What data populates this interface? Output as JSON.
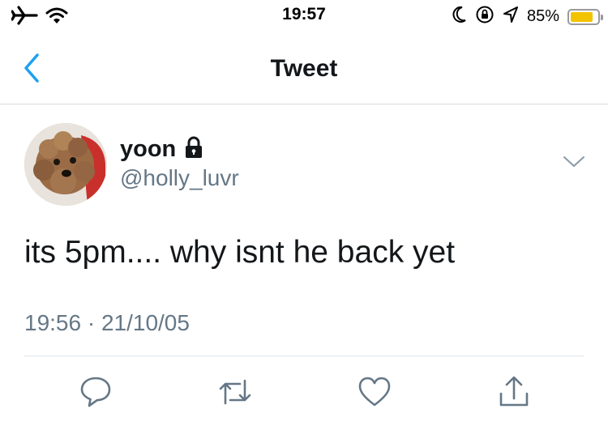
{
  "status_bar": {
    "time": "19:57",
    "battery_percent": "85%",
    "battery_level": 0.85,
    "battery_color": "#f2c300",
    "icons": [
      "airplane-icon",
      "wifi-icon",
      "moon-icon",
      "rotation-lock-icon",
      "location-icon",
      "battery-icon"
    ]
  },
  "nav": {
    "title": "Tweet",
    "back_icon": "chevron-left-icon",
    "accent_color": "#1da1f2"
  },
  "tweet": {
    "display_name": "yoon",
    "handle": "@holly_luvr",
    "protected_icon": "lock-icon",
    "text": "its 5pm.... why isnt he back yet",
    "timestamp": "19:56 · 21/10/05",
    "more_icon": "chevron-down-icon"
  },
  "actions": {
    "icons": [
      "reply-icon",
      "retweet-icon",
      "like-icon",
      "share-icon"
    ],
    "icon_color": "#657786"
  }
}
